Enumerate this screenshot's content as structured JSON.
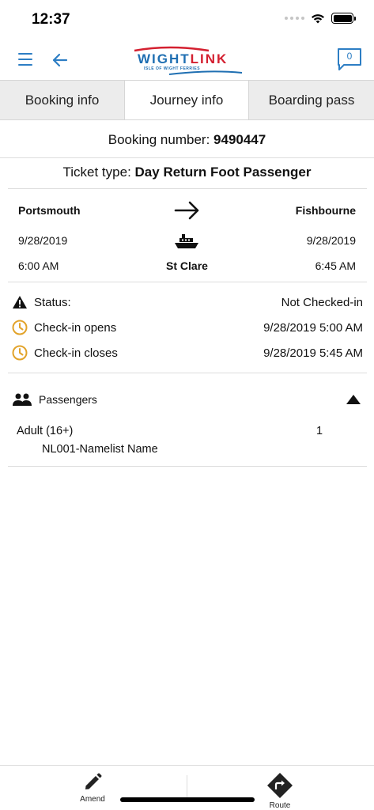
{
  "status_bar": {
    "time": "12:37"
  },
  "header": {
    "logo_word_1": "WIGHT",
    "logo_word_2": "LINK",
    "logo_tagline": "ISLE OF WIGHT FERRIES",
    "chat_count": "0"
  },
  "tabs": [
    {
      "label": "Booking info",
      "active": false
    },
    {
      "label": "Journey info",
      "active": true
    },
    {
      "label": "Boarding pass",
      "active": false
    }
  ],
  "booking": {
    "number_label": "Booking number:",
    "number": "9490447"
  },
  "ticket": {
    "type_label": "Ticket type:",
    "type": "Day Return Foot Passenger"
  },
  "journey": {
    "origin": "Portsmouth",
    "destination": "Fishbourne",
    "depart_date": "9/28/2019",
    "arrive_date": "9/28/2019",
    "depart_time": "6:00 AM",
    "arrive_time": "6:45 AM",
    "vessel": "St Clare"
  },
  "checkin": {
    "status_label": "Status:",
    "status_value": "Not Checked-in",
    "opens_label": "Check-in opens",
    "opens_value": "9/28/2019 5:00 AM",
    "closes_label": "Check-in closes",
    "closes_value": "9/28/2019 5:45 AM"
  },
  "passengers": {
    "title": "Passengers",
    "items": [
      {
        "category": "Adult (16+)",
        "count": "1",
        "name": "NL001-Namelist Name"
      }
    ]
  },
  "bottom_bar": {
    "amend_label": "Amend",
    "route_label": "Route"
  },
  "colors": {
    "accent": "#2d7ec4",
    "clock": "#e2a32a",
    "brand_red": "#d42030",
    "brand_blue": "#1f6fb2"
  }
}
